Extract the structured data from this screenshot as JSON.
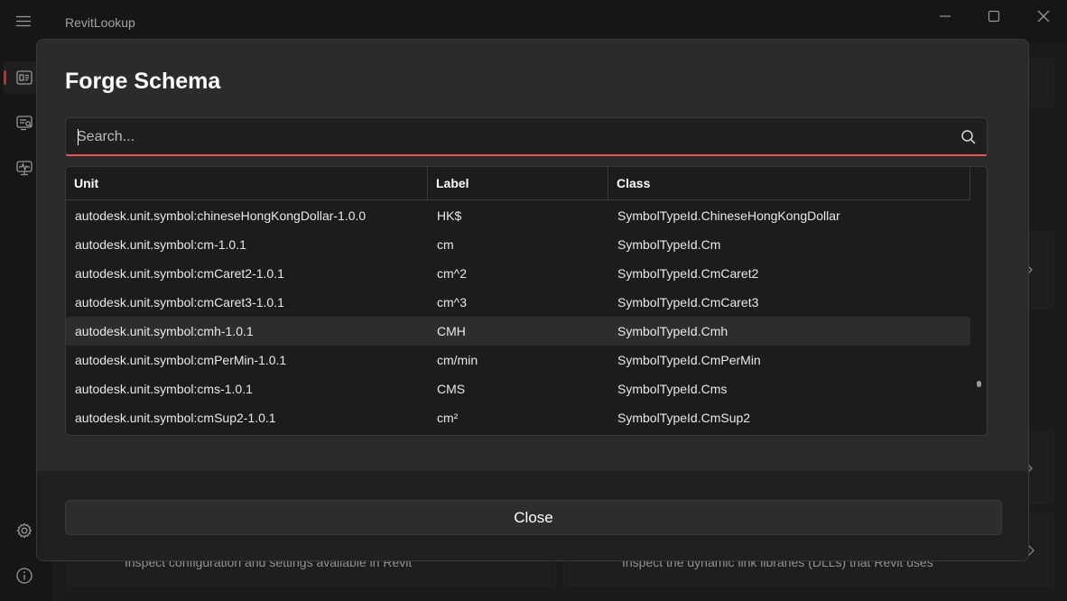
{
  "app": {
    "title": "RevitLookup"
  },
  "background": {
    "card_left_text": "Inspect configuration and settings available in Revit",
    "card_right_text": "Inspect the dynamic link libraries (DLLs) that Revit uses"
  },
  "dialog": {
    "title": "Forge Schema",
    "search": {
      "placeholder": "Search...",
      "value": ""
    },
    "table": {
      "columns": [
        "Unit",
        "Label",
        "Class"
      ],
      "selected_index": 4,
      "rows": [
        {
          "unit": "autodesk.unit.symbol:chineseHongKongDollar-1.0.0",
          "label": "HK$",
          "class": "SymbolTypeId.ChineseHongKongDollar"
        },
        {
          "unit": "autodesk.unit.symbol:cm-1.0.1",
          "label": "cm",
          "class": "SymbolTypeId.Cm"
        },
        {
          "unit": "autodesk.unit.symbol:cmCaret2-1.0.1",
          "label": "cm^2",
          "class": "SymbolTypeId.CmCaret2"
        },
        {
          "unit": "autodesk.unit.symbol:cmCaret3-1.0.1",
          "label": "cm^3",
          "class": "SymbolTypeId.CmCaret3"
        },
        {
          "unit": "autodesk.unit.symbol:cmh-1.0.1",
          "label": "CMH",
          "class": "SymbolTypeId.Cmh"
        },
        {
          "unit": "autodesk.unit.symbol:cmPerMin-1.0.1",
          "label": "cm/min",
          "class": "SymbolTypeId.CmPerMin"
        },
        {
          "unit": "autodesk.unit.symbol:cms-1.0.1",
          "label": "CMS",
          "class": "SymbolTypeId.Cms"
        },
        {
          "unit": "autodesk.unit.symbol:cmSup2-1.0.1",
          "label": "cm²",
          "class": "SymbolTypeId.CmSup2"
        }
      ]
    },
    "close_label": "Close"
  },
  "icons": {
    "rail": [
      "dashboard-icon",
      "events-icon",
      "monitor-icon"
    ],
    "rail_bottom": [
      "settings-icon",
      "info-icon"
    ]
  },
  "colors": {
    "accent": "#e95452"
  }
}
